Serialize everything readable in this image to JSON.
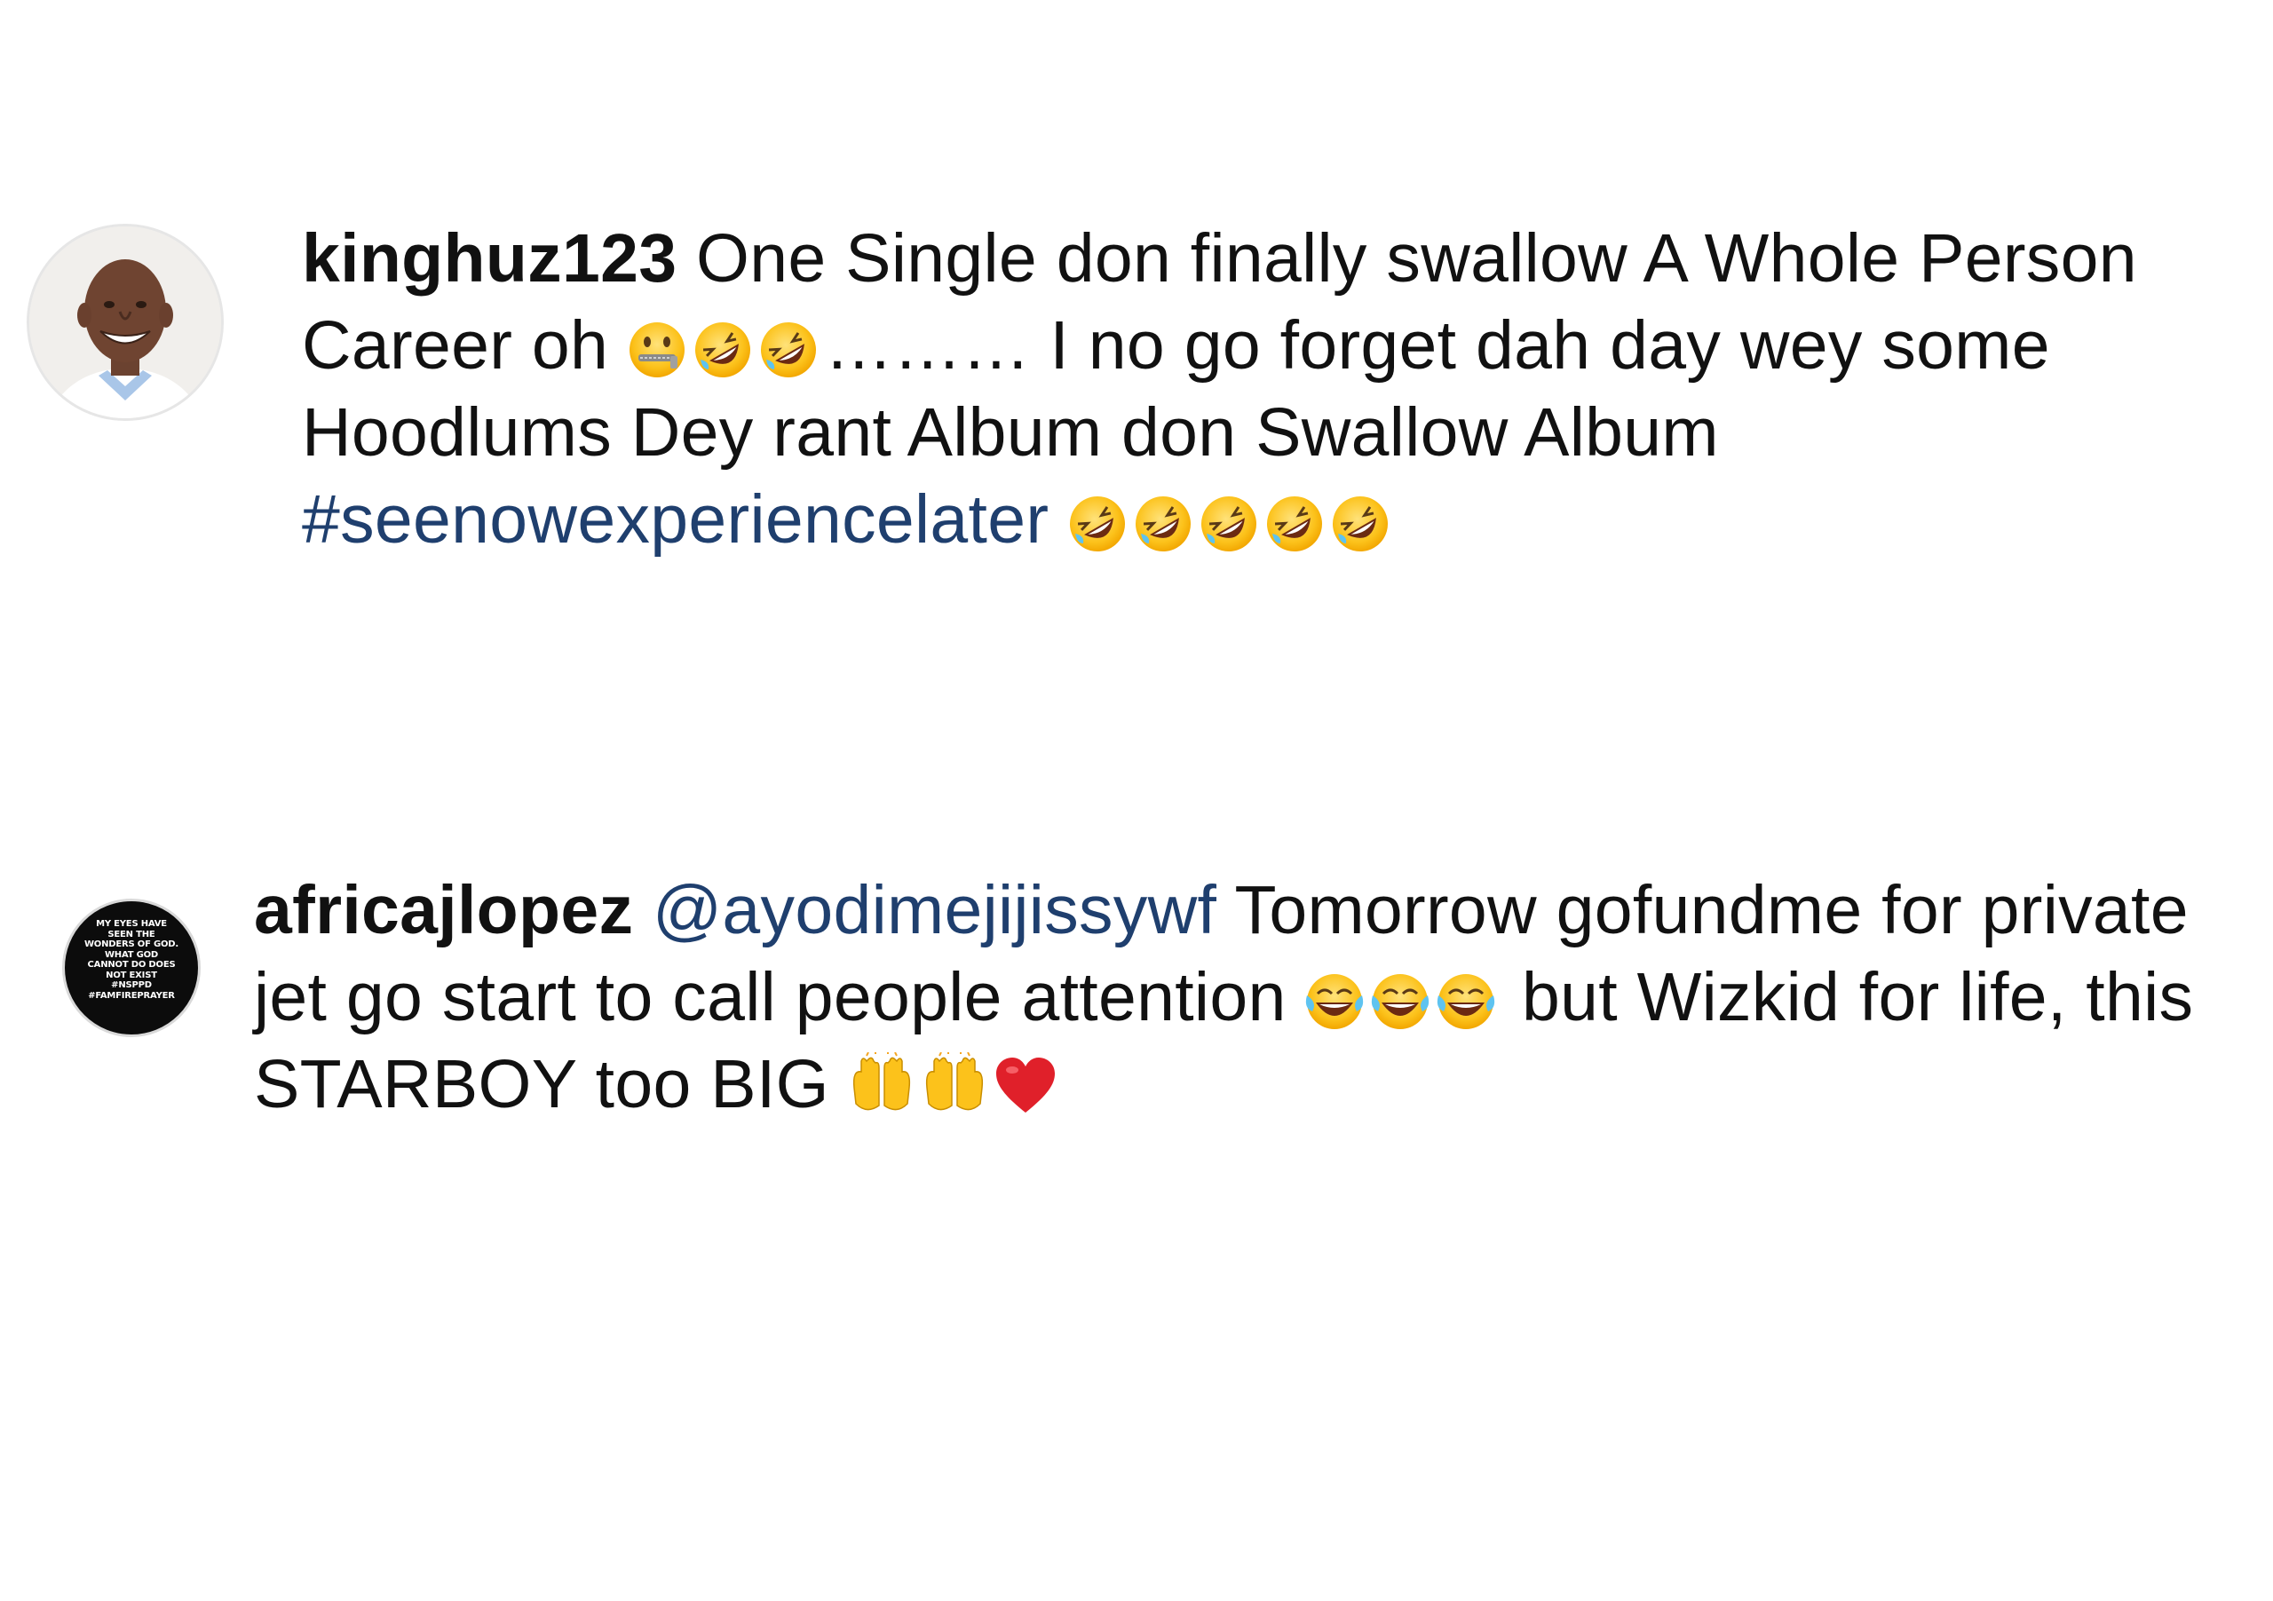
{
  "comments": [
    {
      "username": "kinghuz123",
      "text_1": " One Single don finally swallow A Whole Person Career oh ",
      "text_2": "……… I no go forget dah day wey some Hoodlums Dey rant Album don Swallow Album ",
      "hashtag": "#seenowexperiencelater",
      "text_3": " ",
      "avatar": "profile-photo-man-smiling"
    },
    {
      "username": "africajlopez",
      "mention": "@ayodimejijissywf",
      "text_1": " Tomorrow gofundme for private jet go start to call people attention ",
      "text_2": " but Wizkid for life, this STARBOY too BIG ",
      "avatar_text": "MY EYES HAVE\nSEEN THE\nWONDERS OF GOD.\nWHAT GOD\nCANNOT DO DOES\nNOT EXIST\n#NSPPD\n#FAMFIREPRAYER"
    }
  ],
  "icons": {
    "zipper_mouth": "zipper-mouth-face-emoji",
    "rofl": "rolling-on-floor-laughing-emoji",
    "joy": "face-with-tears-of-joy-emoji",
    "raising_hands": "raising-hands-emoji",
    "heart": "red-heart-emoji"
  },
  "colors": {
    "text": "#111111",
    "link": "#1f3f6e",
    "background": "#ffffff"
  }
}
